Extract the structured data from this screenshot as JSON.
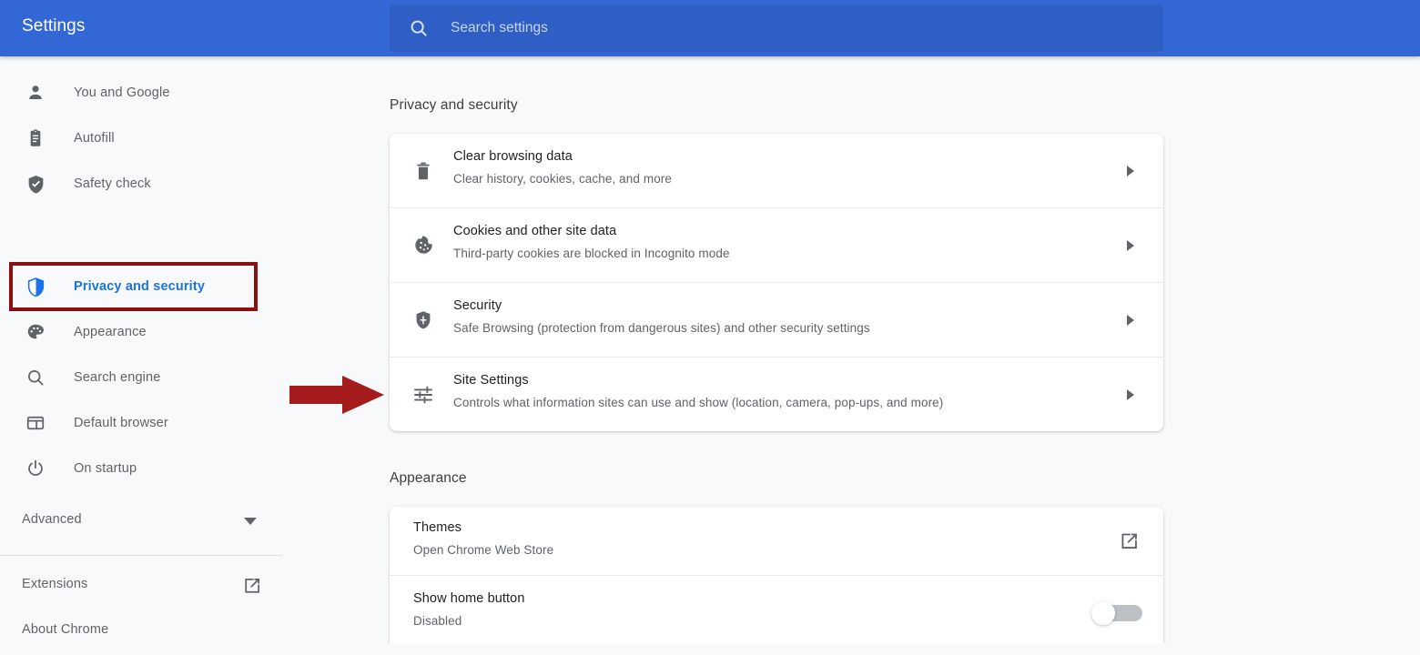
{
  "header": {
    "title": "Settings",
    "search": {
      "placeholder": "Search settings",
      "value": "",
      "icon": "search-icon"
    },
    "background_color": "#3367d6",
    "search_background_color": "#2f5fc4"
  },
  "sidebar": {
    "items": [
      {
        "label": "You and Google",
        "icon": "person-icon",
        "selected": false
      },
      {
        "label": "Autofill",
        "icon": "clipboard-icon",
        "selected": false
      },
      {
        "label": "Safety check",
        "icon": "shield-check-icon",
        "selected": false
      },
      {
        "label": "Privacy and security",
        "icon": "shield-split-icon",
        "selected": true
      },
      {
        "label": "Appearance",
        "icon": "palette-icon",
        "selected": false
      },
      {
        "label": "Search engine",
        "icon": "magnifier-icon",
        "selected": false
      },
      {
        "label": "Default browser",
        "icon": "browser-window-icon",
        "selected": false
      },
      {
        "label": "On startup",
        "icon": "power-icon",
        "selected": false
      }
    ],
    "advanced": {
      "label": "Advanced",
      "icon": "chevron-down-icon"
    },
    "bottom_links": [
      {
        "label": "Extensions",
        "icon": "external-link-icon"
      },
      {
        "label": "About Chrome",
        "icon": null
      }
    ],
    "selected_color": "#1a73e8",
    "text_color": "#5f6368"
  },
  "main": {
    "sections": [
      {
        "title": "Privacy and security",
        "rows": [
          {
            "title": "Clear browsing data",
            "subtitle": "Clear history, cookies, cache, and more",
            "icon": "trash-icon",
            "control": "chevron-right-icon"
          },
          {
            "title": "Cookies and other site data",
            "subtitle": "Third-party cookies are blocked in Incognito mode",
            "icon": "cookie-icon",
            "control": "chevron-right-icon"
          },
          {
            "title": "Security",
            "subtitle": "Safe Browsing (protection from dangerous sites) and other security settings",
            "icon": "shield-icon",
            "control": "chevron-right-icon"
          },
          {
            "title": "Site Settings",
            "subtitle": "Controls what information sites can use and show (location, camera, pop-ups, and more)",
            "icon": "tune-sliders-icon",
            "control": "chevron-right-icon"
          }
        ]
      },
      {
        "title": "Appearance",
        "rows": [
          {
            "title": "Themes",
            "subtitle": "Open Chrome Web Store",
            "icon": null,
            "control": "external-link-icon"
          },
          {
            "title": "Show home button",
            "subtitle": "Disabled",
            "icon": null,
            "control": "toggle-switch-off"
          }
        ]
      }
    ]
  },
  "annotations": {
    "highlight_box": {
      "target": "Privacy and security",
      "color": "#8b0f11"
    },
    "arrow": {
      "target": "Site Settings",
      "direction": "right",
      "color": "#a61b1b"
    }
  }
}
